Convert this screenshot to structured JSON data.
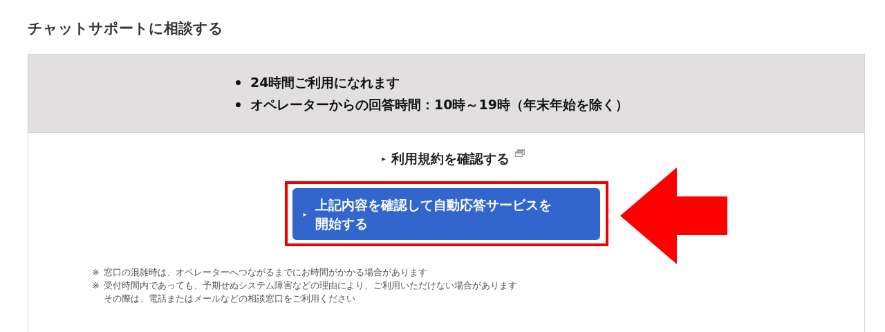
{
  "title": "チャットサポートに相談する",
  "info": [
    "24時間ご利用になれます",
    "オペレーターからの回答時間：10時～19時（年末年始を除く）"
  ],
  "terms_link": {
    "marker": "▸",
    "label": "利用規約を確認する"
  },
  "start_button": {
    "marker": "▸",
    "lines": [
      "上記内容を確認して自動応答サービスを",
      "開始する"
    ]
  },
  "notes": [
    {
      "mark": "※",
      "lines": [
        "窓口の混雑時は、オペレーターへつながるまでにお時間がかかる場合があります"
      ]
    },
    {
      "mark": "※",
      "lines": [
        "受付時間内であっても、予期せぬシステム障害などの理由により、ご利用いただけない場合があります",
        "その際は、電話またはメールなどの相談窓口をご利用ください"
      ]
    }
  ]
}
